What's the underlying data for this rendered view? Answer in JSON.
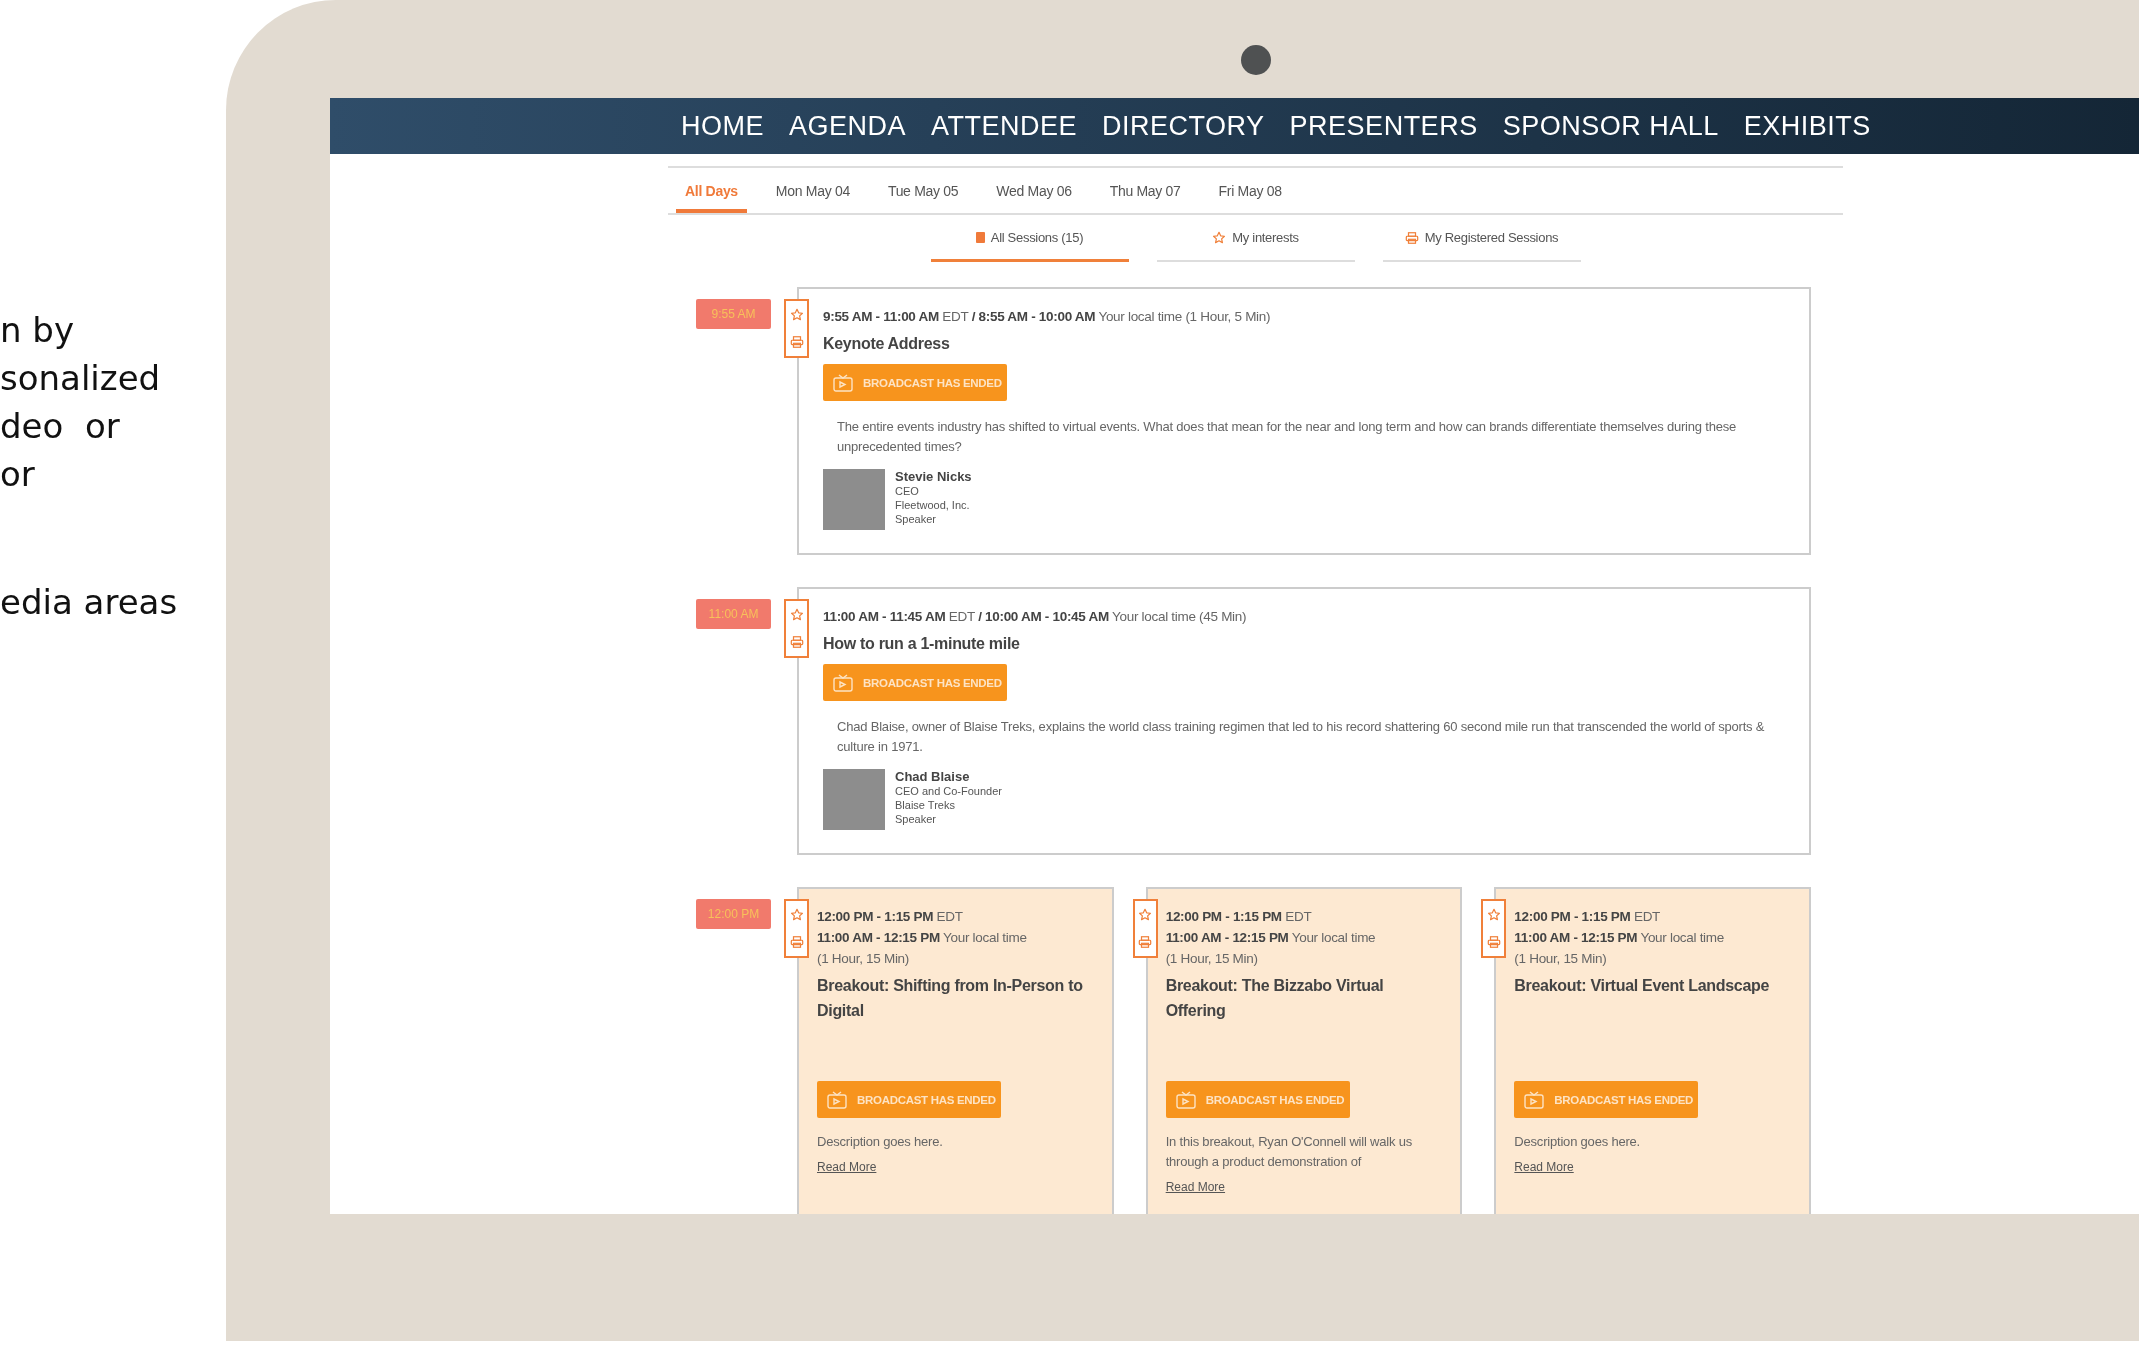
{
  "side_text": [
    [
      "n by",
      "sonalized",
      "deo  or",
      "or"
    ],
    [
      "edia areas"
    ]
  ],
  "nav": [
    {
      "label": "HOME"
    },
    {
      "label": "AGENDA"
    },
    {
      "label": "ATTENDEE"
    },
    {
      "label": "DIRECTORY"
    },
    {
      "label": "PRESENTERS"
    },
    {
      "label": "SPONSOR HALL"
    },
    {
      "label": "EXHIBITS"
    }
  ],
  "day_tabs": [
    {
      "label": "All Days",
      "selected": true
    },
    {
      "label": "Mon May 04",
      "selected": false
    },
    {
      "label": "Tue May 05",
      "selected": false
    },
    {
      "label": "Wed May 06",
      "selected": false
    },
    {
      "label": "Thu May 07",
      "selected": false
    },
    {
      "label": "Fri May 08",
      "selected": false
    }
  ],
  "session_tabs": [
    {
      "label": "All Sessions (15)",
      "selected": true
    },
    {
      "label": "My interests",
      "selected": false
    },
    {
      "label": "My Registered Sessions",
      "selected": false
    }
  ],
  "sessions": [
    {
      "time_badge": "9:55 AM",
      "cards": [
        {
          "kind": "wide",
          "time_lines": [
            "**9:55 AM - 11:00 AM** EDT **/ 8:55 AM - 10:00 AM** Your local time  (1 Hour, 5 Min)"
          ],
          "title": "Keynote Address",
          "button": "BROADCAST HAS ENDED",
          "description": "The entire events industry has shifted to virtual events. What does that mean for the near and long term and how can brands differentiate themselves during these unprecedented times?",
          "speaker": {
            "name": "Stevie Nicks",
            "details": [
              "CEO",
              "Fleetwood, Inc.",
              "Speaker"
            ]
          }
        }
      ]
    },
    {
      "time_badge": "11:00 AM",
      "cards": [
        {
          "kind": "wide",
          "time_lines": [
            "**11:00 AM - 11:45 AM** EDT **/ 10:00 AM - 10:45 AM** Your local time  (45 Min)"
          ],
          "title": "How to run a 1-minute mile",
          "button": "BROADCAST HAS ENDED",
          "description": "Chad Blaise, owner of Blaise Treks, explains the world class training regimen that led to his record shattering 60 second mile run that transcended the world of sports & culture in 1971.",
          "speaker": {
            "name": "Chad Blaise",
            "details": [
              "CEO and Co-Founder",
              "Blaise Treks",
              "Speaker"
            ]
          }
        }
      ]
    },
    {
      "time_badge": "12:00 PM",
      "cards": [
        {
          "kind": "breakout",
          "time_lines": [
            "**12:00 PM - 1:15 PM** EDT",
            "**11:00 AM - 12:15 PM** Your local time",
            "(1 Hour, 15 Min)"
          ],
          "title": "Breakout: Shifting from In-Person to Digital",
          "button": "BROADCAST HAS ENDED",
          "description": "Description goes here.",
          "link": "Read More"
        },
        {
          "kind": "breakout",
          "time_lines": [
            "**12:00 PM - 1:15 PM** EDT",
            "**11:00 AM - 12:15 PM** Your local time",
            "(1 Hour, 15 Min)"
          ],
          "title": "Breakout: The Bizzabo Virtual Offering",
          "button": "BROADCAST HAS ENDED",
          "description": "In this breakout, Ryan O'Connell will walk us through a product demonstration of",
          "link": "Read More"
        },
        {
          "kind": "breakout",
          "time_lines": [
            "**12:00 PM - 1:15 PM** EDT",
            "**11:00 AM - 12:15 PM** Your local time",
            "(1 Hour, 15 Min)"
          ],
          "title": "Breakout: Virtual Event Landscape",
          "button": "BROADCAST HAS ENDED",
          "description": "Description goes here.",
          "link": "Read More"
        }
      ]
    }
  ]
}
